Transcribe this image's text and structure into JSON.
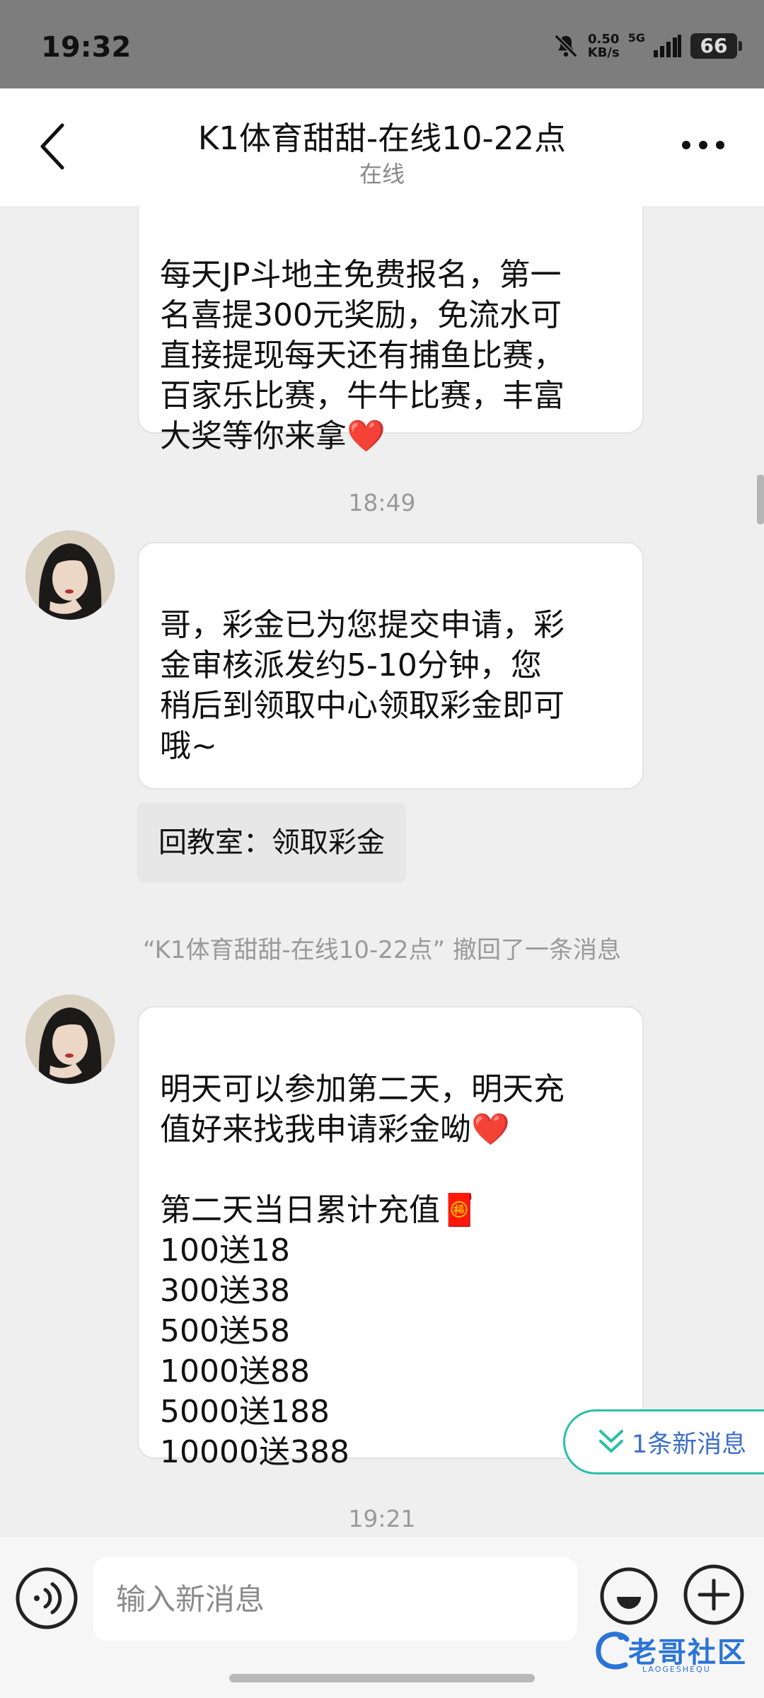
{
  "status_bar": {
    "time": "19:32",
    "net_speed_value": "0.50",
    "net_speed_unit": "KB/s",
    "network": "5G",
    "battery": "66",
    "icons": [
      "mute-bell-icon",
      "signal-icon",
      "battery-icon"
    ]
  },
  "header": {
    "title": "K1体育甜甜-在线10-22点",
    "subtitle": "在线",
    "icons": [
      "back-chevron-icon",
      "more-dots-icon"
    ]
  },
  "messages": [
    {
      "type": "incoming",
      "text": "每天JP斗地主免费报名，第一\n名喜提300元奖励，免流水可\n直接提现每天还有捕鱼比赛，\n百家乐比赛，牛牛比赛，丰富\n大奖等你来拿❤️"
    },
    {
      "type": "time",
      "text": "18:49"
    },
    {
      "type": "incoming",
      "text": "哥，彩金已为您提交申请，彩\n金审核派发约5-10分钟，您\n稍后到领取中心领取彩金即可\n哦~"
    },
    {
      "type": "quick-reply",
      "text": "回教室：领取彩金"
    },
    {
      "type": "recall",
      "text": "“K1体育甜甜-在线10-22点” 撤回了一条消息"
    },
    {
      "type": "incoming",
      "text": "明天可以参加第二天，明天充\n值好来找我申请彩金呦❤️\n\n第二天当日累计充值🧧\n100送18\n300送38\n500送58\n1000送88\n5000送188\n10000送388"
    },
    {
      "type": "time",
      "text": "19:21"
    }
  ],
  "new_message_pill": {
    "label": "1条新消息",
    "icon": "double-chevron-down-icon"
  },
  "input_bar": {
    "placeholder": "输入新消息",
    "icons": [
      "voice-icon",
      "emoji-icon",
      "plus-icon"
    ]
  },
  "watermark": {
    "text": "老哥社区",
    "sub": "LAOGESHEQU"
  },
  "colors": {
    "status_bar_bg": "#7d7d7e",
    "chat_bg": "#efefef",
    "accent_teal": "#2dbfa7",
    "link_blue": "#3e6fc7"
  }
}
